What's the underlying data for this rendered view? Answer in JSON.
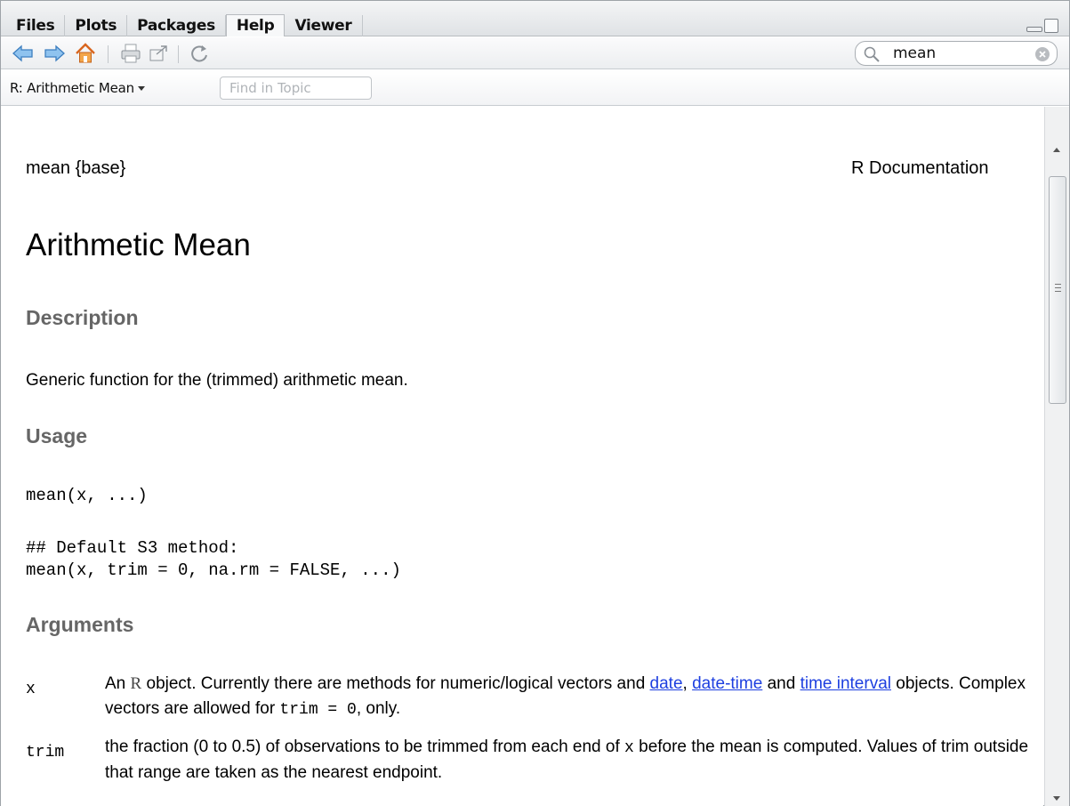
{
  "tabs": [
    {
      "label": "Files",
      "active": false
    },
    {
      "label": "Plots",
      "active": false
    },
    {
      "label": "Packages",
      "active": false
    },
    {
      "label": "Help",
      "active": true
    },
    {
      "label": "Viewer",
      "active": false
    }
  ],
  "toolbar": {
    "icons": [
      "back-arrow-icon",
      "forward-arrow-icon",
      "home-icon",
      "print-icon",
      "open-in-window-icon",
      "refresh-icon"
    ],
    "search": {
      "value": "mean"
    }
  },
  "topicbar": {
    "topic": "R: Arithmetic Mean",
    "find_placeholder": "Find in Topic"
  },
  "doc": {
    "header_left": "mean {base}",
    "header_right": "R Documentation",
    "title": "Arithmetic Mean",
    "description_heading": "Description",
    "description_text": "Generic function for the (trimmed) arithmetic mean.",
    "usage_heading": "Usage",
    "usage_line1": "mean(x, ...)",
    "usage_comment": "## Default S3 method:",
    "usage_line2": "mean(x, trim = 0, na.rm = FALSE, ...)",
    "arguments_heading": "Arguments",
    "arg_x": {
      "name": "x",
      "t1": "An ",
      "r": "R",
      "t2": " object. Currently there are methods for numeric/logical vectors and ",
      "link1": "date",
      "t3": ", ",
      "link2": "date-time",
      "t4": " and ",
      "link3": "time interval",
      "t5": " objects. Complex vectors are allowed for ",
      "code": "trim = 0",
      "t6": ", only."
    },
    "arg_trim": {
      "name": "trim",
      "t1": "the fraction (0 to 0.5) of observations to be trimmed from each end of ",
      "code": "x",
      "t2": " before the mean is computed. Values of trim outside that range are taken as the nearest endpoint."
    }
  },
  "colors": {
    "heading": "#666666",
    "link": "#1d3fe0",
    "home_icon": "#e0822a",
    "nav_arrows": "#5aa0dc"
  }
}
